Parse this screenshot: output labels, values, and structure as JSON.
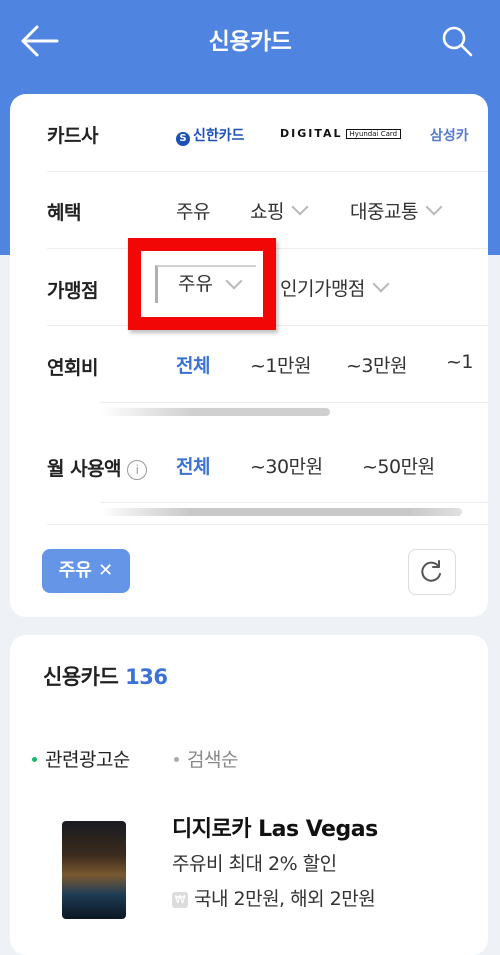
{
  "header": {
    "title": "신용카드",
    "back_icon": "arrow-left-icon",
    "search_icon": "search-icon",
    "bg_color": "#4f85e0"
  },
  "filters": {
    "issuer": {
      "label": "카드사",
      "options": [
        "신한카드",
        "DIGITAL",
        "Hyundai Card",
        "삼성카"
      ]
    },
    "benefit": {
      "label": "혜택",
      "options": [
        "주유",
        "쇼핑",
        "대중교통"
      ]
    },
    "merchant": {
      "label": "가맹점",
      "options": [
        "주유",
        "인기가맹점"
      ]
    },
    "annual_fee": {
      "label": "연회비",
      "options": [
        "전체",
        "~1만원",
        "~3만원",
        "~1"
      ],
      "selected": "전체"
    },
    "monthly_spend": {
      "label": "월 사용액",
      "info_icon": "info-icon",
      "options": [
        "전체",
        "~30만원",
        "~50만원"
      ],
      "selected": "전체"
    },
    "active_chip": {
      "label": "주유",
      "remove": "✕"
    },
    "reset_icon": "refresh-icon"
  },
  "list": {
    "title": "신용카드",
    "count": "136",
    "sort": [
      "관련광고순",
      "검색순"
    ],
    "items": [
      {
        "name": "디지로카 Las Vegas",
        "desc": "주유비 최대 2% 할인",
        "fee_icon": "₩",
        "fee": "국내 2만원, 해외 2만원"
      }
    ]
  },
  "colors": {
    "accent": "#3a72d6",
    "highlight": "#f20707",
    "chip": "#6595e6"
  }
}
